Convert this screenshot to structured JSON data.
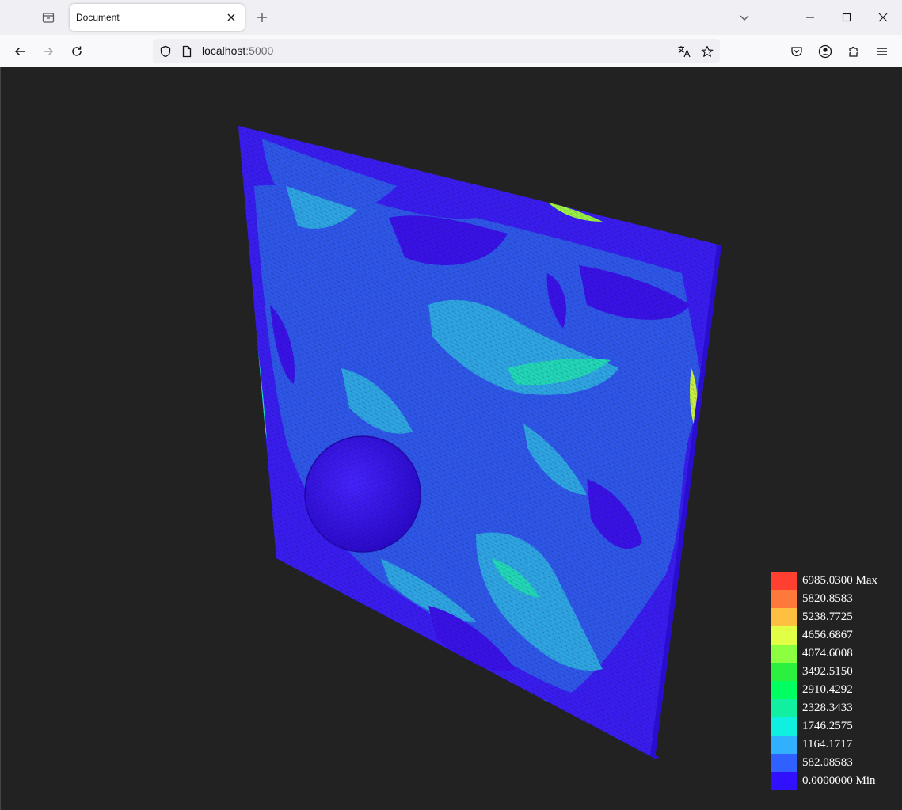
{
  "browser": {
    "tab_title": "Document",
    "url_host": "localhost",
    "url_port": ":5000",
    "icons": {
      "tab_list": "tab-list-icon",
      "close_tab": "close-icon",
      "new_tab": "plus-icon",
      "list_all_tabs": "chevron-down-icon",
      "minimize": "minimize-icon",
      "maximize": "maximize-icon",
      "close_window": "close-icon",
      "back": "back-arrow-icon",
      "forward": "forward-arrow-icon",
      "reload": "reload-icon",
      "tracking_protection": "shield-icon",
      "page_info": "page-icon",
      "translate": "translate-icon",
      "bookmark": "star-icon",
      "pocket": "pocket-icon",
      "account": "account-icon",
      "extensions": "puzzle-icon",
      "menu": "hamburger-menu-icon"
    }
  },
  "viewer": {
    "background": "#222222",
    "mesh_colors": {
      "min": "#3a0ff0",
      "low": "#2f55e8",
      "mid": "#2fa8e6",
      "high": "#1ee8b0",
      "peak": "#d6ff3a"
    },
    "legend": [
      {
        "label": "6985.0300 Max",
        "color": "#ff4030"
      },
      {
        "label": "5820.8583",
        "color": "#ff7a3a"
      },
      {
        "label": "5238.7725",
        "color": "#ffbf40"
      },
      {
        "label": "4656.6867",
        "color": "#e0ff45"
      },
      {
        "label": "4074.6008",
        "color": "#8cff40"
      },
      {
        "label": "3492.5150",
        "color": "#2cf040"
      },
      {
        "label": "2910.4292",
        "color": "#00ff60"
      },
      {
        "label": "2328.3433",
        "color": "#10f0a0"
      },
      {
        "label": "1746.2575",
        "color": "#10f0e0"
      },
      {
        "label": "1164.1717",
        "color": "#30b0ff"
      },
      {
        "label": "582.08583",
        "color": "#3060ff"
      },
      {
        "label": "0.0000000 Min",
        "color": "#3010ff"
      }
    ]
  }
}
